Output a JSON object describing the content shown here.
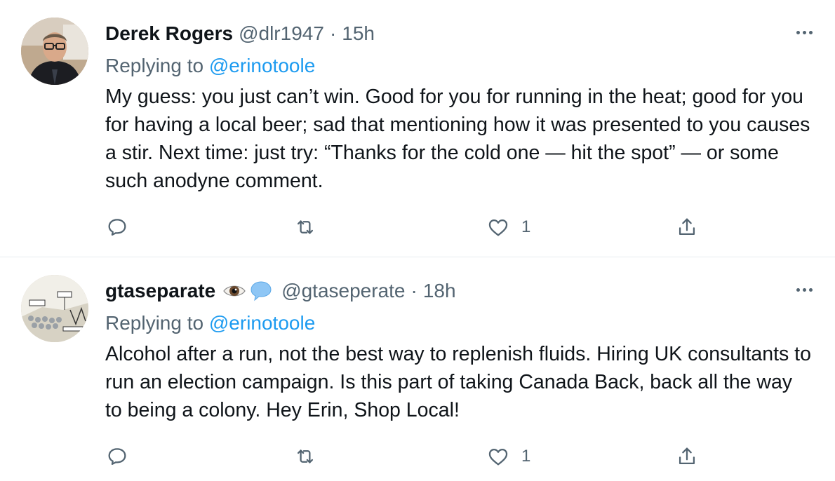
{
  "tweets": [
    {
      "name": "Derek Rogers",
      "handle": "@dlr1947",
      "separator": "·",
      "time": "15h",
      "replying_prefix": "Replying to",
      "replying_to": "@erinotoole",
      "text": "My guess: you just can’t win. Good for you for running in the heat; good for you for having a local beer; sad that mentioning how it was presented to you causes a stir. Next time: just try: “Thanks for the cold one — hit the spot” — or some such anodyne comment.",
      "reply_count": "",
      "retweet_count": "",
      "like_count": "1"
    },
    {
      "name": "gtaseparate",
      "emojis": [
        "eye-icon",
        "speech-balloon-icon"
      ],
      "handle": "@gtaseperate",
      "separator": "·",
      "time": "18h",
      "replying_prefix": "Replying to",
      "replying_to": "@erinotoole",
      "text": "Alcohol after a run, not the best way to replenish fluids. Hiring UK consultants to run an election campaign. Is this part of taking Canada Back, back all the way to being a colony. Hey Erin, Shop Local!",
      "reply_count": "",
      "retweet_count": "",
      "like_count": "1"
    }
  ],
  "colors": {
    "text": "#0f1419",
    "secondary": "#536471",
    "link": "#1d9bf0",
    "divider": "#e6ecf0"
  }
}
